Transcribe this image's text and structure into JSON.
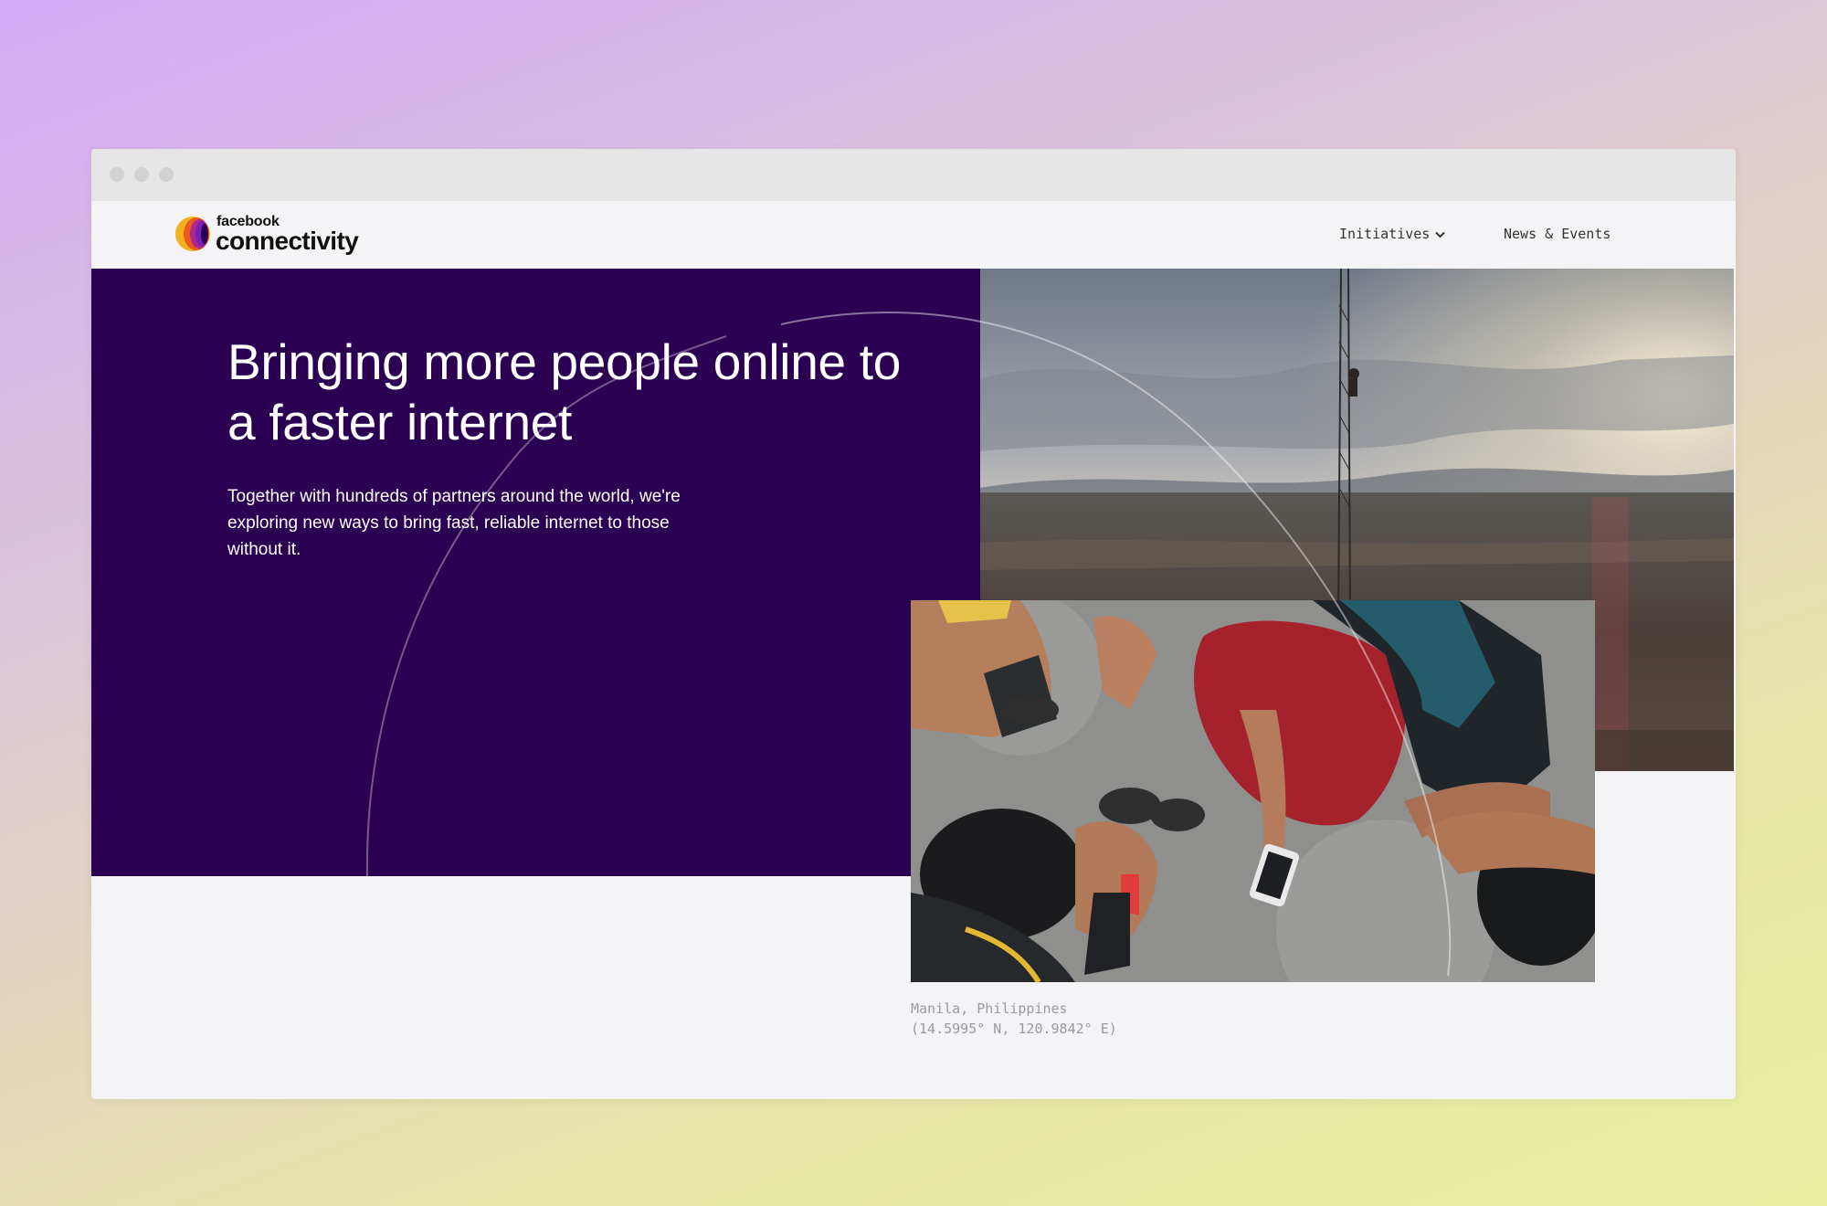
{
  "brand": {
    "top_label": "facebook",
    "name": "connectivity",
    "logo_icon": "connectivity-ring-logo-icon",
    "colors": {
      "ring_yellow": "#f2b21e",
      "ring_orange": "#ea5a1e",
      "ring_purple": "#7a1fb8"
    }
  },
  "nav": {
    "items": [
      {
        "label": "Initiatives",
        "has_dropdown": true,
        "icon": "chevron-down-icon"
      },
      {
        "label": "News & Events"
      }
    ]
  },
  "hero": {
    "headline": "Bringing more people online to a faster internet",
    "body": "Together with hundreds of partners around the world, we're exploring new ways to bring fast, reliable internet to those without it.",
    "background_color": "#2b0052"
  },
  "photos": {
    "top": {
      "alt": "Technician climbing a telecommunications tower above a landscape at sunset"
    },
    "bottom": {
      "alt": "Kids and a man gathered around a smartphone on a concrete floor"
    },
    "caption_place": "Manila, Philippines",
    "caption_coords": "(14.5995° N, 120.9842° E)"
  }
}
